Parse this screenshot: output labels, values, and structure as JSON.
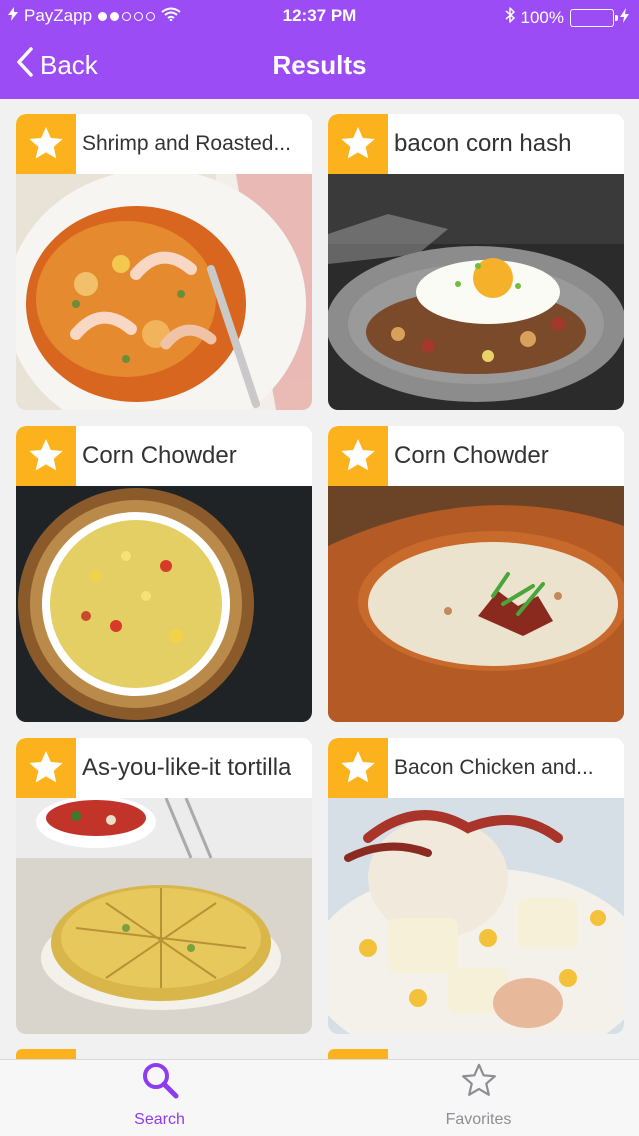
{
  "status_bar": {
    "carrier": "PayZapp",
    "time": "12:37 PM",
    "battery": "100%",
    "signal_icon": "signal-dots-icon",
    "wifi_icon": "wifi-icon",
    "bluetooth_icon": "bluetooth-icon",
    "battery_icon": "battery-icon"
  },
  "nav": {
    "back_label": "Back",
    "title": "Results"
  },
  "recipes": [
    {
      "title": "Shrimp and Roasted..."
    },
    {
      "title": "bacon corn hash"
    },
    {
      "title": "Corn Chowder"
    },
    {
      "title": "Corn Chowder"
    },
    {
      "title": "As-you-like-it tortilla"
    },
    {
      "title": "Bacon Chicken and..."
    }
  ],
  "tabs": [
    {
      "label": "Search",
      "icon": "search-icon",
      "active": true
    },
    {
      "label": "Favorites",
      "icon": "star-outline-icon",
      "active": false
    }
  ],
  "colors": {
    "accent": "#9b4cf5",
    "star_badge": "#fbb21c",
    "tab_active": "#8e3cf0",
    "tab_inactive": "#8e8e93"
  }
}
